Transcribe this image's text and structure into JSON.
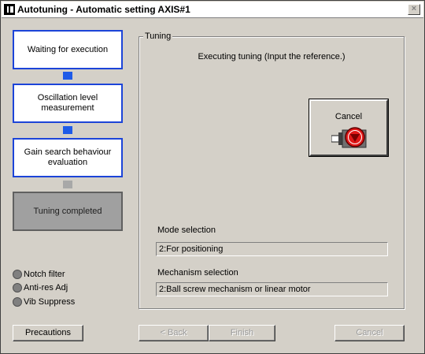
{
  "window": {
    "title": "Autotuning - Automatic setting AXIS#1",
    "close_label": "×"
  },
  "steps": [
    {
      "label": "Waiting for execution",
      "state": "active"
    },
    {
      "label": "Oscillation level measurement",
      "state": "active"
    },
    {
      "label": "Gain search behaviour evaluation",
      "state": "active"
    },
    {
      "label": "Tuning completed",
      "state": "completed"
    }
  ],
  "options": [
    {
      "label": "Notch filter"
    },
    {
      "label": "Anti-res Adj"
    },
    {
      "label": "Vib Suppress"
    }
  ],
  "tuning": {
    "group_label": "Tuning",
    "status": "Executing tuning (Input the reference.)",
    "cancel_label": "Cancel",
    "cancel_icon": "motor-stop-icon",
    "mode_label": "Mode selection",
    "mode_value": "2:For positioning",
    "mechanism_label": "Mechanism selection",
    "mechanism_value": "2:Ball screw mechanism or linear motor"
  },
  "buttons": {
    "precautions": "Precautions",
    "back": "< Back",
    "finish": "Finish",
    "cancel": "Cancel"
  },
  "colors": {
    "step_border": "#1c44d8",
    "connector": "#1e5be8",
    "stop_red": "#e01818"
  }
}
